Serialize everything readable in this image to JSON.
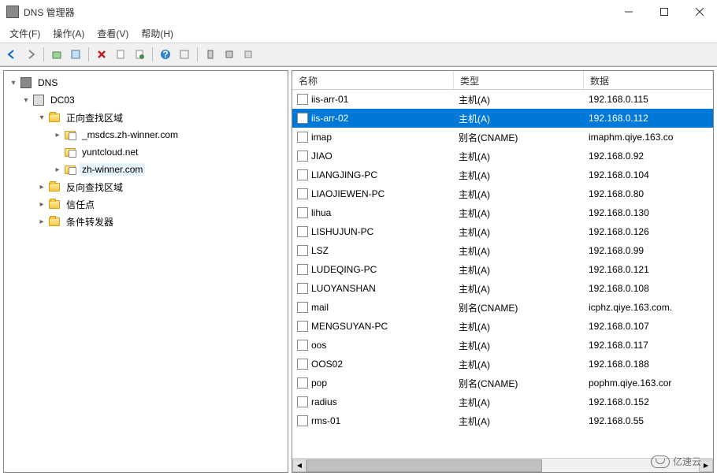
{
  "titlebar": {
    "title": "DNS 管理器"
  },
  "menu": {
    "file": "文件(F)",
    "action": "操作(A)",
    "view": "查看(V)",
    "help": "帮助(H)"
  },
  "tree": {
    "root": "DNS",
    "server": "DC03",
    "forward_zones": "正向查找区域",
    "zone_msdcs": "_msdcs.zh-winner.com",
    "zone_yuntcloud": "yuntcloud.net",
    "zone_zhwinner": "zh-winner.com",
    "reverse_zones": "反向查找区域",
    "trust_points": "信任点",
    "conditional_fwd": "条件转发器"
  },
  "list": {
    "headers": {
      "name": "名称",
      "type": "类型",
      "data": "数据"
    },
    "rows": [
      {
        "name": "iis-arr-01",
        "type": "主机(A)",
        "data": "192.168.0.115",
        "selected": false
      },
      {
        "name": "iis-arr-02",
        "type": "主机(A)",
        "data": "192.168.0.112",
        "selected": true
      },
      {
        "name": "imap",
        "type": "别名(CNAME)",
        "data": "imaphm.qiye.163.co",
        "selected": false
      },
      {
        "name": "JIAO",
        "type": "主机(A)",
        "data": "192.168.0.92",
        "selected": false
      },
      {
        "name": "LIANGJING-PC",
        "type": "主机(A)",
        "data": "192.168.0.104",
        "selected": false
      },
      {
        "name": "LIAOJIEWEN-PC",
        "type": "主机(A)",
        "data": "192.168.0.80",
        "selected": false
      },
      {
        "name": "lihua",
        "type": "主机(A)",
        "data": "192.168.0.130",
        "selected": false
      },
      {
        "name": "LISHUJUN-PC",
        "type": "主机(A)",
        "data": "192.168.0.126",
        "selected": false
      },
      {
        "name": "LSZ",
        "type": "主机(A)",
        "data": "192.168.0.99",
        "selected": false
      },
      {
        "name": "LUDEQING-PC",
        "type": "主机(A)",
        "data": "192.168.0.121",
        "selected": false
      },
      {
        "name": "LUOYANSHAN",
        "type": "主机(A)",
        "data": "192.168.0.108",
        "selected": false
      },
      {
        "name": "mail",
        "type": "别名(CNAME)",
        "data": "icphz.qiye.163.com.",
        "selected": false
      },
      {
        "name": "MENGSUYAN-PC",
        "type": "主机(A)",
        "data": "192.168.0.107",
        "selected": false
      },
      {
        "name": "oos",
        "type": "主机(A)",
        "data": "192.168.0.117",
        "selected": false
      },
      {
        "name": "OOS02",
        "type": "主机(A)",
        "data": "192.168.0.188",
        "selected": false
      },
      {
        "name": "pop",
        "type": "别名(CNAME)",
        "data": "pophm.qiye.163.cor",
        "selected": false
      },
      {
        "name": "radius",
        "type": "主机(A)",
        "data": "192.168.0.152",
        "selected": false
      },
      {
        "name": "rms-01",
        "type": "主机(A)",
        "data": "192.168.0.55",
        "selected": false
      }
    ]
  },
  "watermark": "亿速云"
}
